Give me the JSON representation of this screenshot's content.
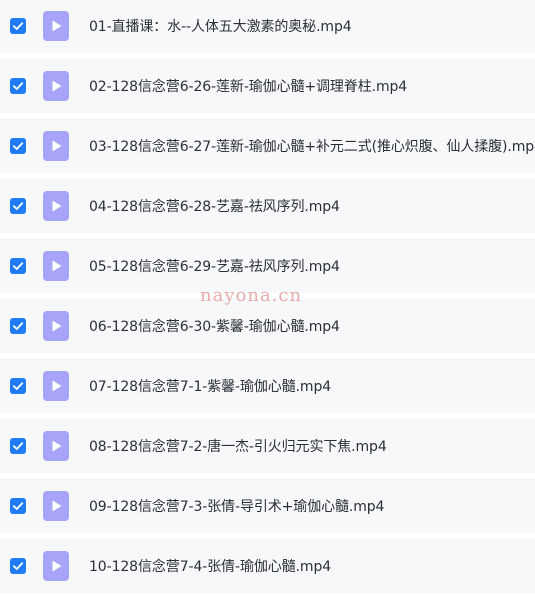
{
  "colors": {
    "checkbox": "#1f7cf5",
    "icon_bg": "#a8a4f8",
    "row_bg": "#f7f8fa",
    "text": "#2b2f36",
    "watermark": "#e8a2a2"
  },
  "icons": {
    "checkbox": "check-icon",
    "file": "video-file-icon"
  },
  "files": [
    {
      "name": "01-直播课：水--人体五大激素的奥秘.mp4",
      "checked": true
    },
    {
      "name": "02-128信念营6-26-莲新-瑜伽心髓+调理脊柱.mp4",
      "checked": true
    },
    {
      "name": "03-128信念营6-27-莲新-瑜伽心髓+补元二式(推心炽腹、仙人揉腹).mp4",
      "checked": true
    },
    {
      "name": "04-128信念营6-28-艺嘉-祛风序列.mp4",
      "checked": true
    },
    {
      "name": "05-128信念营6-29-艺嘉-祛风序列.mp4",
      "checked": true
    },
    {
      "name": "06-128信念营6-30-紫馨-瑜伽心髓.mp4",
      "checked": true
    },
    {
      "name": "07-128信念营7-1-紫馨-瑜伽心髓.mp4",
      "checked": true
    },
    {
      "name": "08-128信念营7-2-唐一杰-引火归元实下焦.mp4",
      "checked": true
    },
    {
      "name": "09-128信念营7-3-张倩-导引术+瑜伽心髓.mp4",
      "checked": true
    },
    {
      "name": "10-128信念营7-4-张倩-瑜伽心髓.mp4",
      "checked": true
    }
  ],
  "watermark": "nayona.cn"
}
